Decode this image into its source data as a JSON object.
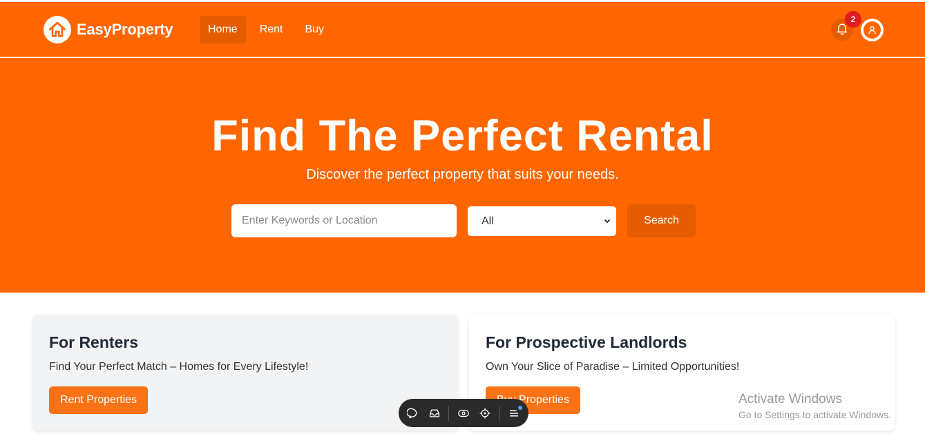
{
  "brand": {
    "name": "EasyProperty",
    "logo_icon": "house-icon"
  },
  "nav": {
    "links": [
      {
        "label": "Home",
        "active": true
      },
      {
        "label": "Rent",
        "active": false
      },
      {
        "label": "Buy",
        "active": false
      }
    ],
    "notifications": {
      "icon": "bell-icon",
      "count": "2"
    },
    "profile_icon": "user-icon"
  },
  "hero": {
    "title": "Find The Perfect Rental",
    "subtitle": "Discover the perfect property that suits your needs.",
    "search": {
      "placeholder": "Enter Keywords or Location",
      "value": "",
      "select_value": "All",
      "button_label": "Search"
    }
  },
  "cards": [
    {
      "title": "For Renters",
      "text": "Find Your Perfect Match – Homes for Every Lifestyle!",
      "button_label": "Rent Properties"
    },
    {
      "title": "For Prospective Landlords",
      "text": "Own Your Slice of Paradise – Limited Opportunities!",
      "button_label": "Buy Properties"
    }
  ],
  "toolbar": {
    "icons": [
      "comment-icon",
      "inbox-icon",
      "eye-icon",
      "target-icon",
      "menu-icon"
    ]
  },
  "watermark": {
    "title": "Activate Windows",
    "subtitle": "Go to Settings to activate Windows."
  },
  "colors": {
    "primary": "#ff6600",
    "primary_dark": "#e65c00",
    "button": "#f97316",
    "badge": "#e31b23"
  }
}
